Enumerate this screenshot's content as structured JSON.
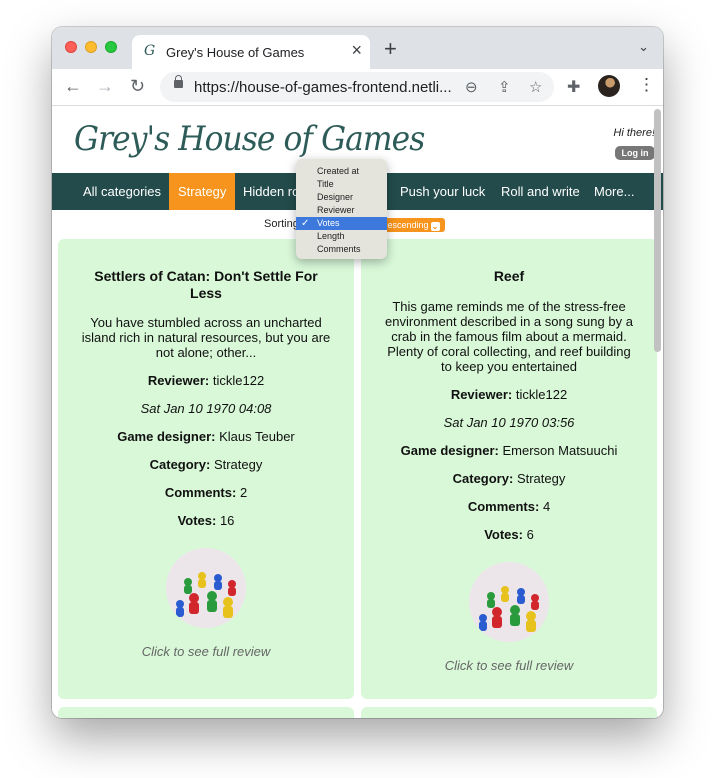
{
  "browser": {
    "tab_title": "Grey's House of Games",
    "tab_favicon": "G",
    "url": "https://house-of-games-frontend.netli...",
    "icons": [
      "back-arrow-icon",
      "forward-arrow-icon",
      "reload-icon",
      "lock-icon",
      "zoom-icon",
      "share-icon",
      "star-icon",
      "extensions-icon",
      "profile-avatar",
      "kebab-menu-icon"
    ]
  },
  "site": {
    "logo": "Grey's House of Games",
    "greeting": "Hi there!",
    "login_label": "Log in",
    "accent_color": "#f7941d",
    "nav_color": "#234b4b"
  },
  "nav": {
    "items": [
      "All categories",
      "Strategy",
      "Hidden ro",
      "Push your luck",
      "Roll and write",
      "More..."
    ],
    "active": "Strategy"
  },
  "sort": {
    "label": "Sorting",
    "order_value": "Descending",
    "options": [
      "Created at",
      "Title",
      "Designer",
      "Reviewer",
      "Votes",
      "Length",
      "Comments"
    ],
    "selected": "Votes"
  },
  "reviews": [
    {
      "title": "Settlers of Catan: Don't Settle For Less",
      "body": "You have stumbled across an uncharted island rich in natural resources, but you are not alone; other...",
      "reviewer_label": "Reviewer:",
      "reviewer": "tickle122",
      "date": "Sat Jan 10 1970 04:08",
      "designer_label": "Game designer:",
      "designer": "Klaus Teuber",
      "category_label": "Category:",
      "category": "Strategy",
      "comments_label": "Comments:",
      "comments": "2",
      "votes_label": "Votes:",
      "votes": "16",
      "cta": "Click to see full review"
    },
    {
      "title": "Reef",
      "body": "This game reminds me of the stress-free environment described in a song sung by a crab in the famous film about a mermaid. Plenty of coral collecting, and reef building to keep you entertained",
      "reviewer_label": "Reviewer:",
      "reviewer": "tickle122",
      "date": "Sat Jan 10 1970 03:56",
      "designer_label": "Game designer:",
      "designer": "Emerson Matsuuchi",
      "category_label": "Category:",
      "category": "Strategy",
      "comments_label": "Comments:",
      "comments": "4",
      "votes_label": "Votes:",
      "votes": "6",
      "cta": "Click to see full review"
    }
  ]
}
